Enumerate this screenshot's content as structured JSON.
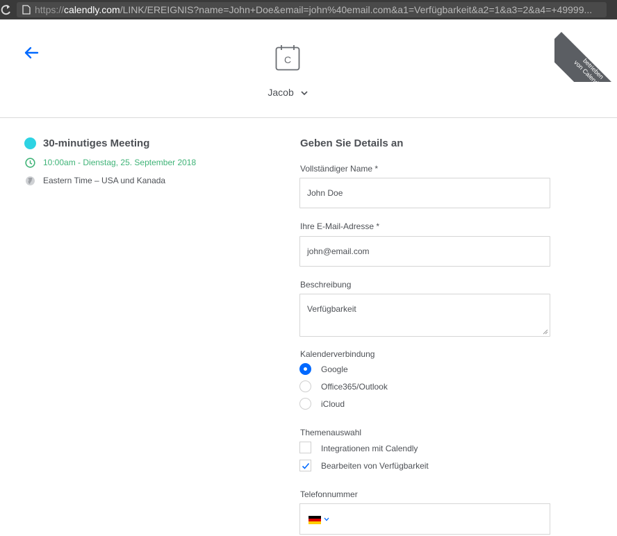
{
  "browser": {
    "url_protocol": "https://",
    "url_host": "calendly.com",
    "url_path": "/LINK/EREIGNIS?name=John+Doe&email=john%40email.com&a1=Verfügbarkeit&a2=1&a3=2&a4=+49999..."
  },
  "header": {
    "host_name": "Jacob",
    "ribbon_line1": "betrieben",
    "ribbon_line2": "von Calendly",
    "logo_letter": "C"
  },
  "event": {
    "name": "30-minutiges Meeting",
    "time": "10:00am - Dienstag, 25. September 2018",
    "timezone": "Eastern Time – USA und Kanada",
    "dot_color": "#2dd3e3"
  },
  "form": {
    "title": "Geben Sie Details an",
    "name_label": "Vollständiger Name *",
    "name_value": "John Doe",
    "email_label": "Ihre E-Mail-Adresse *",
    "email_value": "john@email.com",
    "description_label": "Beschreibung",
    "description_value": "Verfügbarkeit",
    "calendar_label": "Kalenderverbindung",
    "calendar_options": [
      {
        "label": "Google",
        "selected": true
      },
      {
        "label": "Office365/Outlook",
        "selected": false
      },
      {
        "label": "iCloud",
        "selected": false
      }
    ],
    "topics_label": "Themenauswahl",
    "topics": [
      {
        "label": "Integrationen mit Calendly",
        "checked": false
      },
      {
        "label": "Bearbeiten von Verfügbarkeit",
        "checked": true
      }
    ],
    "phone_label": "Telefonnummer",
    "phone_country": "de-flag-icon"
  },
  "colors": {
    "accent_blue": "#0069ff",
    "time_green": "#3fb377",
    "text": "#4d5055"
  }
}
